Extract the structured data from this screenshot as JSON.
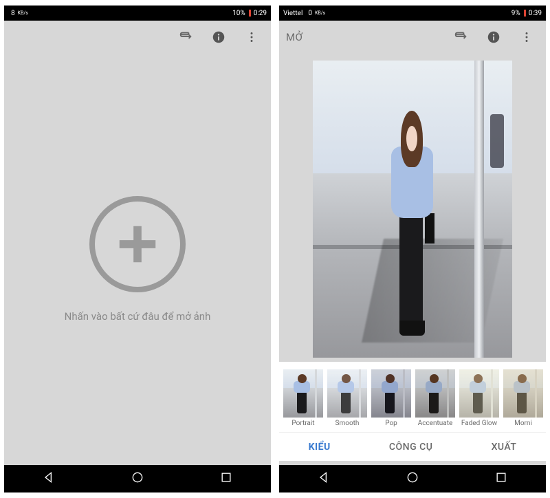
{
  "left": {
    "status": {
      "net": "8",
      "netUnit": "KB/s",
      "battery": "10%",
      "time": "0:29"
    },
    "emptyHint": "Nhấn vào bất cứ đâu để mở ảnh"
  },
  "right": {
    "status": {
      "carrier": "Viettel",
      "net": "0",
      "netUnit": "KB/s",
      "battery": "9%",
      "time": "0:39"
    },
    "toolbar": {
      "open": "MỞ"
    },
    "filters": [
      {
        "label": "Portrait"
      },
      {
        "label": "Smooth"
      },
      {
        "label": "Pop"
      },
      {
        "label": "Accentuate"
      },
      {
        "label": "Faded Glow"
      },
      {
        "label": "Morni"
      }
    ],
    "tabs": {
      "style": "KIỂU",
      "tools": "CÔNG CỤ",
      "export": "XUẤT"
    }
  }
}
